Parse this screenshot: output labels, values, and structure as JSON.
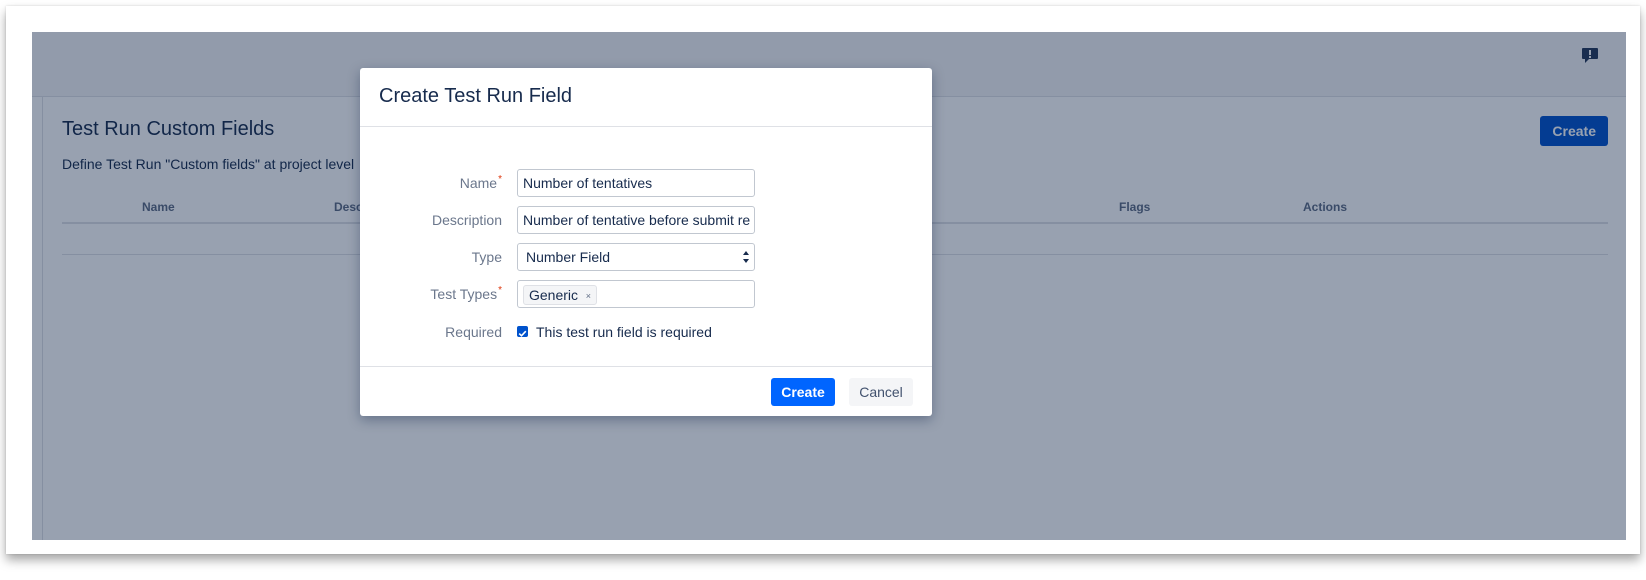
{
  "page": {
    "title": "Test Run Custom Fields",
    "description": "Define Test Run \"Custom fields\" at project level",
    "create_label": "Create",
    "feedback_icon": "feedback-icon"
  },
  "table": {
    "headers": [
      "Name",
      "Descri",
      "Flags",
      "Actions"
    ]
  },
  "dialog": {
    "title": "Create Test Run Field",
    "fields": {
      "name": {
        "label": "Name",
        "required_mark": "*",
        "value": "Number of tentatives"
      },
      "description": {
        "label": "Description",
        "value": "Number of tentative before submit re"
      },
      "type": {
        "label": "Type",
        "value": "Number Field"
      },
      "test_types": {
        "label": "Test Types",
        "required_mark": "*",
        "token": "Generic",
        "token_remove": "×"
      },
      "required": {
        "label": "Required",
        "checked": true,
        "checkbox_label": "This test run field is required"
      }
    },
    "buttons": {
      "create": "Create",
      "cancel": "Cancel"
    }
  },
  "colors": {
    "primary": "#0052cc",
    "dialog_primary": "#0065ff",
    "blanket": "#091e42",
    "required": "#de350b"
  }
}
